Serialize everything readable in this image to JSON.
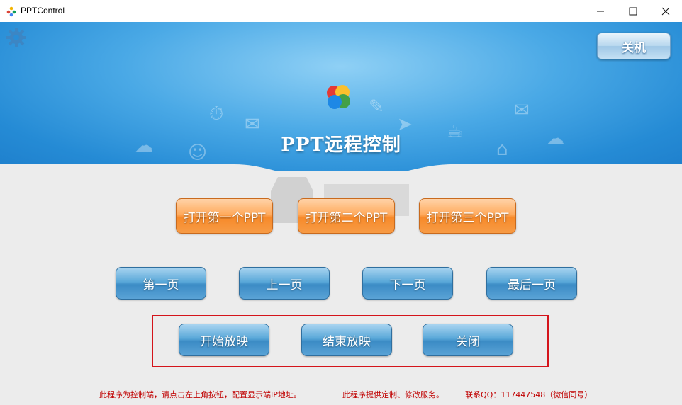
{
  "window": {
    "title": "PPTControl"
  },
  "header": {
    "title": "PPT远程控制",
    "shutdown_label": "关机"
  },
  "open_buttons": [
    "打开第一个PPT",
    "打开第二个PPT",
    "打开第三个PPT"
  ],
  "nav_buttons": [
    "第一页",
    "上一页",
    "下一页",
    "最后一页"
  ],
  "show_buttons": [
    "开始放映",
    "结束放映",
    "关闭"
  ],
  "footer": {
    "note": "此程序为控制端，请点击左上角按钮，配置显示端IP地址。",
    "service": "此程序提供定制、修改服务。",
    "contact": "联系QQ：117447548（微信同号）"
  },
  "colors": {
    "header_blue": "#2a8dd6",
    "orange": "#f78a2a",
    "button_blue": "#3b8bc5",
    "footer_red": "#c00000",
    "highlight_red": "#d4141b"
  },
  "icons": [
    "app-logo-icon",
    "minimize-icon",
    "maximize-icon",
    "close-icon",
    "settings-gear-icon"
  ]
}
